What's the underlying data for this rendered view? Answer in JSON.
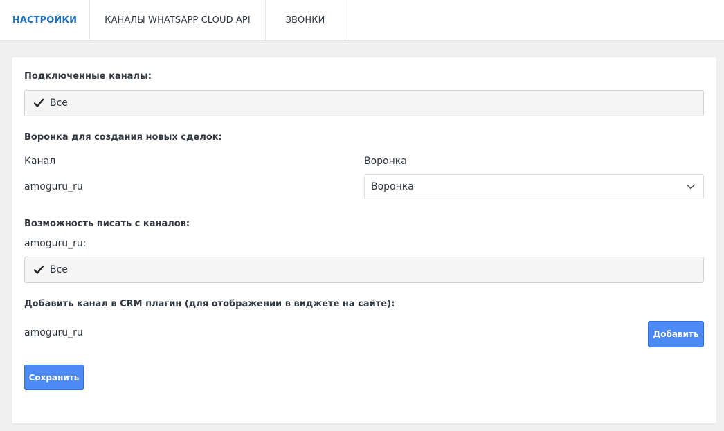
{
  "tabs": [
    {
      "label": "НАСТРОЙКИ",
      "active": true
    },
    {
      "label": "КАНАЛЫ WHATSAPP CLOUD API",
      "active": false
    },
    {
      "label": "ЗВОНКИ",
      "active": false
    }
  ],
  "connected_channels": {
    "heading": "Подключенные каналы:",
    "checkbox_label": "Все",
    "checked": true
  },
  "pipeline": {
    "heading": "Воронка для создания новых сделок:",
    "col_channel": "Канал",
    "col_pipeline": "Воронка",
    "channel_name": "amoguru_ru",
    "select_value": "Воронка"
  },
  "write_from": {
    "heading": "Возможность писать с каналов:",
    "channel_label": "amoguru_ru:",
    "checkbox_label": "Все",
    "checked": true
  },
  "crm_plugin": {
    "heading": "Добавить канал в CRM плагин (для отображении в виджете на сайте):",
    "channel_name": "amoguru_ru",
    "add_label": "Добавить"
  },
  "save_label": "Сохранить",
  "colors": {
    "accent": "#1d6fbd",
    "button": "#4c8bf5"
  }
}
